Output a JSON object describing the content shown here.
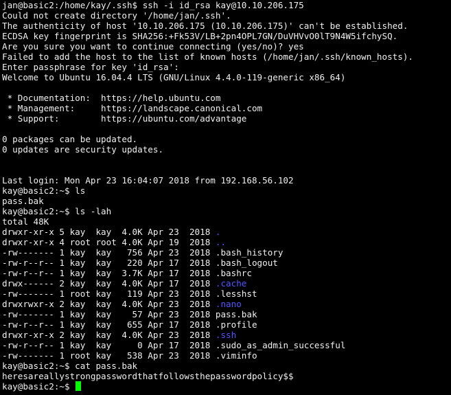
{
  "terminal": {
    "cursor_color": "#00ff00",
    "directory_color": "#5555ff",
    "text_color": "#f0f0f0",
    "background_color": "#000000",
    "lines": [
      {
        "name": "ssh-command-line",
        "text": "jan@basic2:/home/kay/.ssh$ ssh -i id_rsa kay@10.10.206.175"
      },
      {
        "name": "output-line",
        "text": "Could not create directory '/home/jan/.ssh'."
      },
      {
        "name": "output-line",
        "text": "The authenticity of host '10.10.206.175 (10.10.206.175)' can't be established."
      },
      {
        "name": "output-line",
        "text": "ECDSA key fingerprint is SHA256:+Fk53V/LB+2pn4OPL7GN/DuVHVvO0lT9N4W5ifchySQ."
      },
      {
        "name": "output-line",
        "text": "Are you sure you want to continue connecting (yes/no)? yes"
      },
      {
        "name": "output-line",
        "text": "Failed to add the host to the list of known hosts (/home/jan/.ssh/known_hosts)."
      },
      {
        "name": "output-line",
        "text": "Enter passphrase for key 'id_rsa':"
      },
      {
        "name": "output-line",
        "text": "Welcome to Ubuntu 16.04.4 LTS (GNU/Linux 4.4.0-119-generic x86_64)"
      },
      {
        "name": "blank-line",
        "text": ""
      },
      {
        "name": "output-line",
        "text": " * Documentation:  https://help.ubuntu.com"
      },
      {
        "name": "output-line",
        "text": " * Management:     https://landscape.canonical.com"
      },
      {
        "name": "output-line",
        "text": " * Support:        https://ubuntu.com/advantage"
      },
      {
        "name": "blank-line",
        "text": ""
      },
      {
        "name": "output-line",
        "text": "0 packages can be updated."
      },
      {
        "name": "output-line",
        "text": "0 updates are security updates."
      },
      {
        "name": "blank-line",
        "text": ""
      },
      {
        "name": "blank-line",
        "text": ""
      },
      {
        "name": "output-line",
        "text": "Last login: Mon Apr 23 16:04:07 2018 from 192.168.56.102"
      },
      {
        "name": "ls-command-line",
        "text": "kay@basic2:~$ ls"
      },
      {
        "name": "output-line",
        "text": "pass.bak"
      },
      {
        "name": "ls-lah-command-line",
        "text": "kay@basic2:~$ ls -lah"
      },
      {
        "name": "output-line",
        "text": "total 48K"
      }
    ],
    "listing": [
      {
        "meta": "drwxr-xr-x 5 kay  kay  4.0K Apr 23  2018 ",
        "file": ".",
        "dir": true
      },
      {
        "meta": "drwxr-xr-x 4 root root 4.0K Apr 19  2018 ",
        "file": "..",
        "dir": true
      },
      {
        "meta": "-rw------- 1 kay  kay   756 Apr 23  2018 ",
        "file": ".bash_history",
        "dir": false
      },
      {
        "meta": "-rw-r--r-- 1 kay  kay   220 Apr 17  2018 ",
        "file": ".bash_logout",
        "dir": false
      },
      {
        "meta": "-rw-r--r-- 1 kay  kay  3.7K Apr 17  2018 ",
        "file": ".bashrc",
        "dir": false
      },
      {
        "meta": "drwx------ 2 kay  kay  4.0K Apr 17  2018 ",
        "file": ".cache",
        "dir": true
      },
      {
        "meta": "-rw------- 1 root kay   119 Apr 23  2018 ",
        "file": ".lesshst",
        "dir": false
      },
      {
        "meta": "drwxrwxr-x 2 kay  kay  4.0K Apr 23  2018 ",
        "file": ".nano",
        "dir": true
      },
      {
        "meta": "-rw------- 1 kay  kay    57 Apr 23  2018 ",
        "file": "pass.bak",
        "dir": false
      },
      {
        "meta": "-rw-r--r-- 1 kay  kay   655 Apr 17  2018 ",
        "file": ".profile",
        "dir": false
      },
      {
        "meta": "drwxr-xr-x 2 kay  kay  4.0K Apr 23  2018 ",
        "file": ".ssh",
        "dir": true
      },
      {
        "meta": "-rw-r--r-- 1 kay  kay     0 Apr 17  2018 ",
        "file": ".sudo_as_admin_successful",
        "dir": false
      },
      {
        "meta": "-rw------- 1 root kay   538 Apr 23  2018 ",
        "file": ".viminfo",
        "dir": false
      }
    ],
    "after_lines": [
      {
        "name": "cat-command-line",
        "text": "kay@basic2:~$ cat pass.bak"
      },
      {
        "name": "password-output-line",
        "text": "heresareallystrongpasswordthatfollowsthepasswordpolicy$$"
      }
    ],
    "prompt": "kay@basic2:~$ "
  }
}
